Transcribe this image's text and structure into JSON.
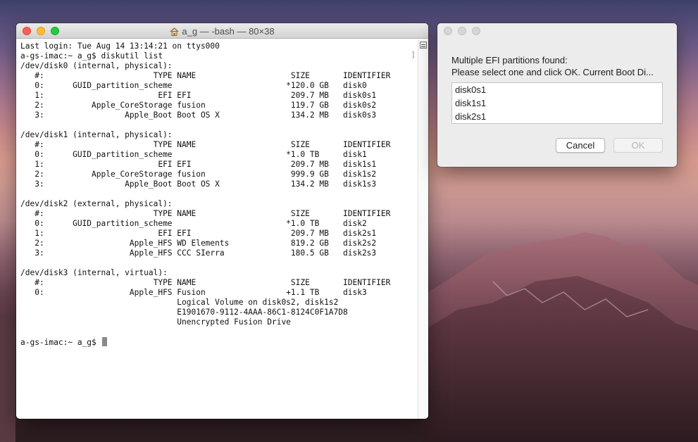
{
  "terminal": {
    "title": "a_g — -bash — 80×38",
    "lines": [
      "Last login: Tue Aug 14 13:14:21 on ttys000",
      "a-gs-imac:~ a_g$ diskutil list",
      "/dev/disk0 (internal, physical):",
      "   #:                       TYPE NAME                    SIZE       IDENTIFIER",
      "   0:      GUID_partition_scheme                        *120.0 GB   disk0",
      "   1:                        EFI EFI                     209.7 MB   disk0s1",
      "   2:          Apple_CoreStorage fusion                  119.7 GB   disk0s2",
      "   3:                 Apple_Boot Boot OS X               134.2 MB   disk0s3",
      "",
      "/dev/disk1 (internal, physical):",
      "   #:                       TYPE NAME                    SIZE       IDENTIFIER",
      "   0:      GUID_partition_scheme                        *1.0 TB     disk1",
      "   1:                        EFI EFI                     209.7 MB   disk1s1",
      "   2:          Apple_CoreStorage fusion                  999.9 GB   disk1s2",
      "   3:                 Apple_Boot Boot OS X               134.2 MB   disk1s3",
      "",
      "/dev/disk2 (external, physical):",
      "   #:                       TYPE NAME                    SIZE       IDENTIFIER",
      "   0:      GUID_partition_scheme                        *1.0 TB     disk2",
      "   1:                        EFI EFI                     209.7 MB   disk2s1",
      "   2:                  Apple_HFS WD Elements             819.2 GB   disk2s2",
      "   3:                  Apple_HFS CCC SIerra              180.5 GB   disk2s3",
      "",
      "/dev/disk3 (internal, virtual):",
      "   #:                       TYPE NAME                    SIZE       IDENTIFIER",
      "   0:                  Apple_HFS Fusion                 +1.1 TB     disk3",
      "                                 Logical Volume on disk0s2, disk1s2",
      "                                 E1901670-9112-4AAA-86C1-8124C0F1A7D8",
      "                                 Unencrypted Fusion Drive",
      ""
    ],
    "prompt": "a-gs-imac:~ a_g$ "
  },
  "dialog": {
    "message_line1": "Multiple EFI partitions found:",
    "message_line2": "Please select one and click OK. Current Boot Di...",
    "list_items": [
      "disk0s1",
      "disk1s1",
      "disk2s1"
    ],
    "cancel_label": "Cancel",
    "ok_label": "OK"
  }
}
